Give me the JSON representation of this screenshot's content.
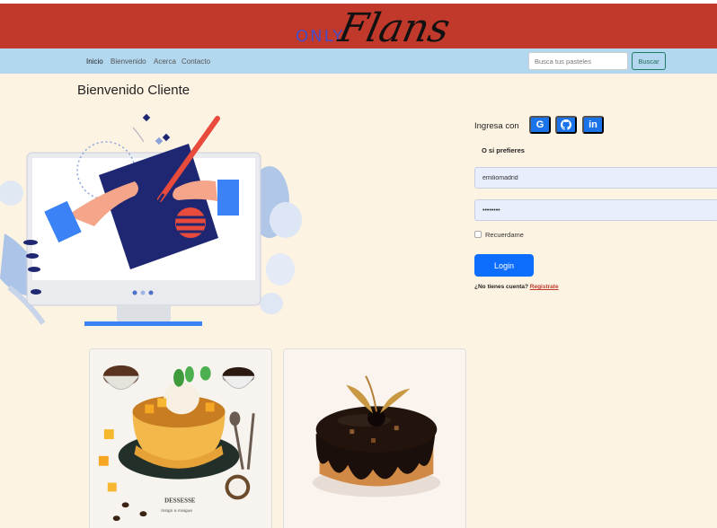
{
  "brand": {
    "only": "ONLY",
    "flans": "Flans"
  },
  "nav": {
    "links": [
      "Inicio",
      "Bienvenido",
      "Acerca",
      "Contacto"
    ],
    "search_placeholder": "Busca tus pasteles",
    "search_button": "Buscar"
  },
  "page": {
    "welcome": "Bienvenido Cliente"
  },
  "login": {
    "ingresa_con": "Ingresa con",
    "social": [
      "G",
      "github-icon",
      "in"
    ],
    "o_si_prefieres": "O si prefieres",
    "username_value": "emiliomadrid",
    "password_value": "••••••••",
    "remember_label": "Recuerdame",
    "login_button": "Login",
    "no_account": "¿No tienes cuenta?",
    "register_link": "Registrate"
  },
  "cards": [
    {
      "image": "flan-dessert-image",
      "caption_title": "DESSESSE",
      "caption_sub": "Insign a maigue"
    },
    {
      "image": "chocolate-cake-image"
    }
  ],
  "colors": {
    "brand_red": "#c0392b",
    "navbar_blue": "#b2d7ef",
    "page_bg": "#fdf3e3",
    "primary": "#0d6efd"
  }
}
